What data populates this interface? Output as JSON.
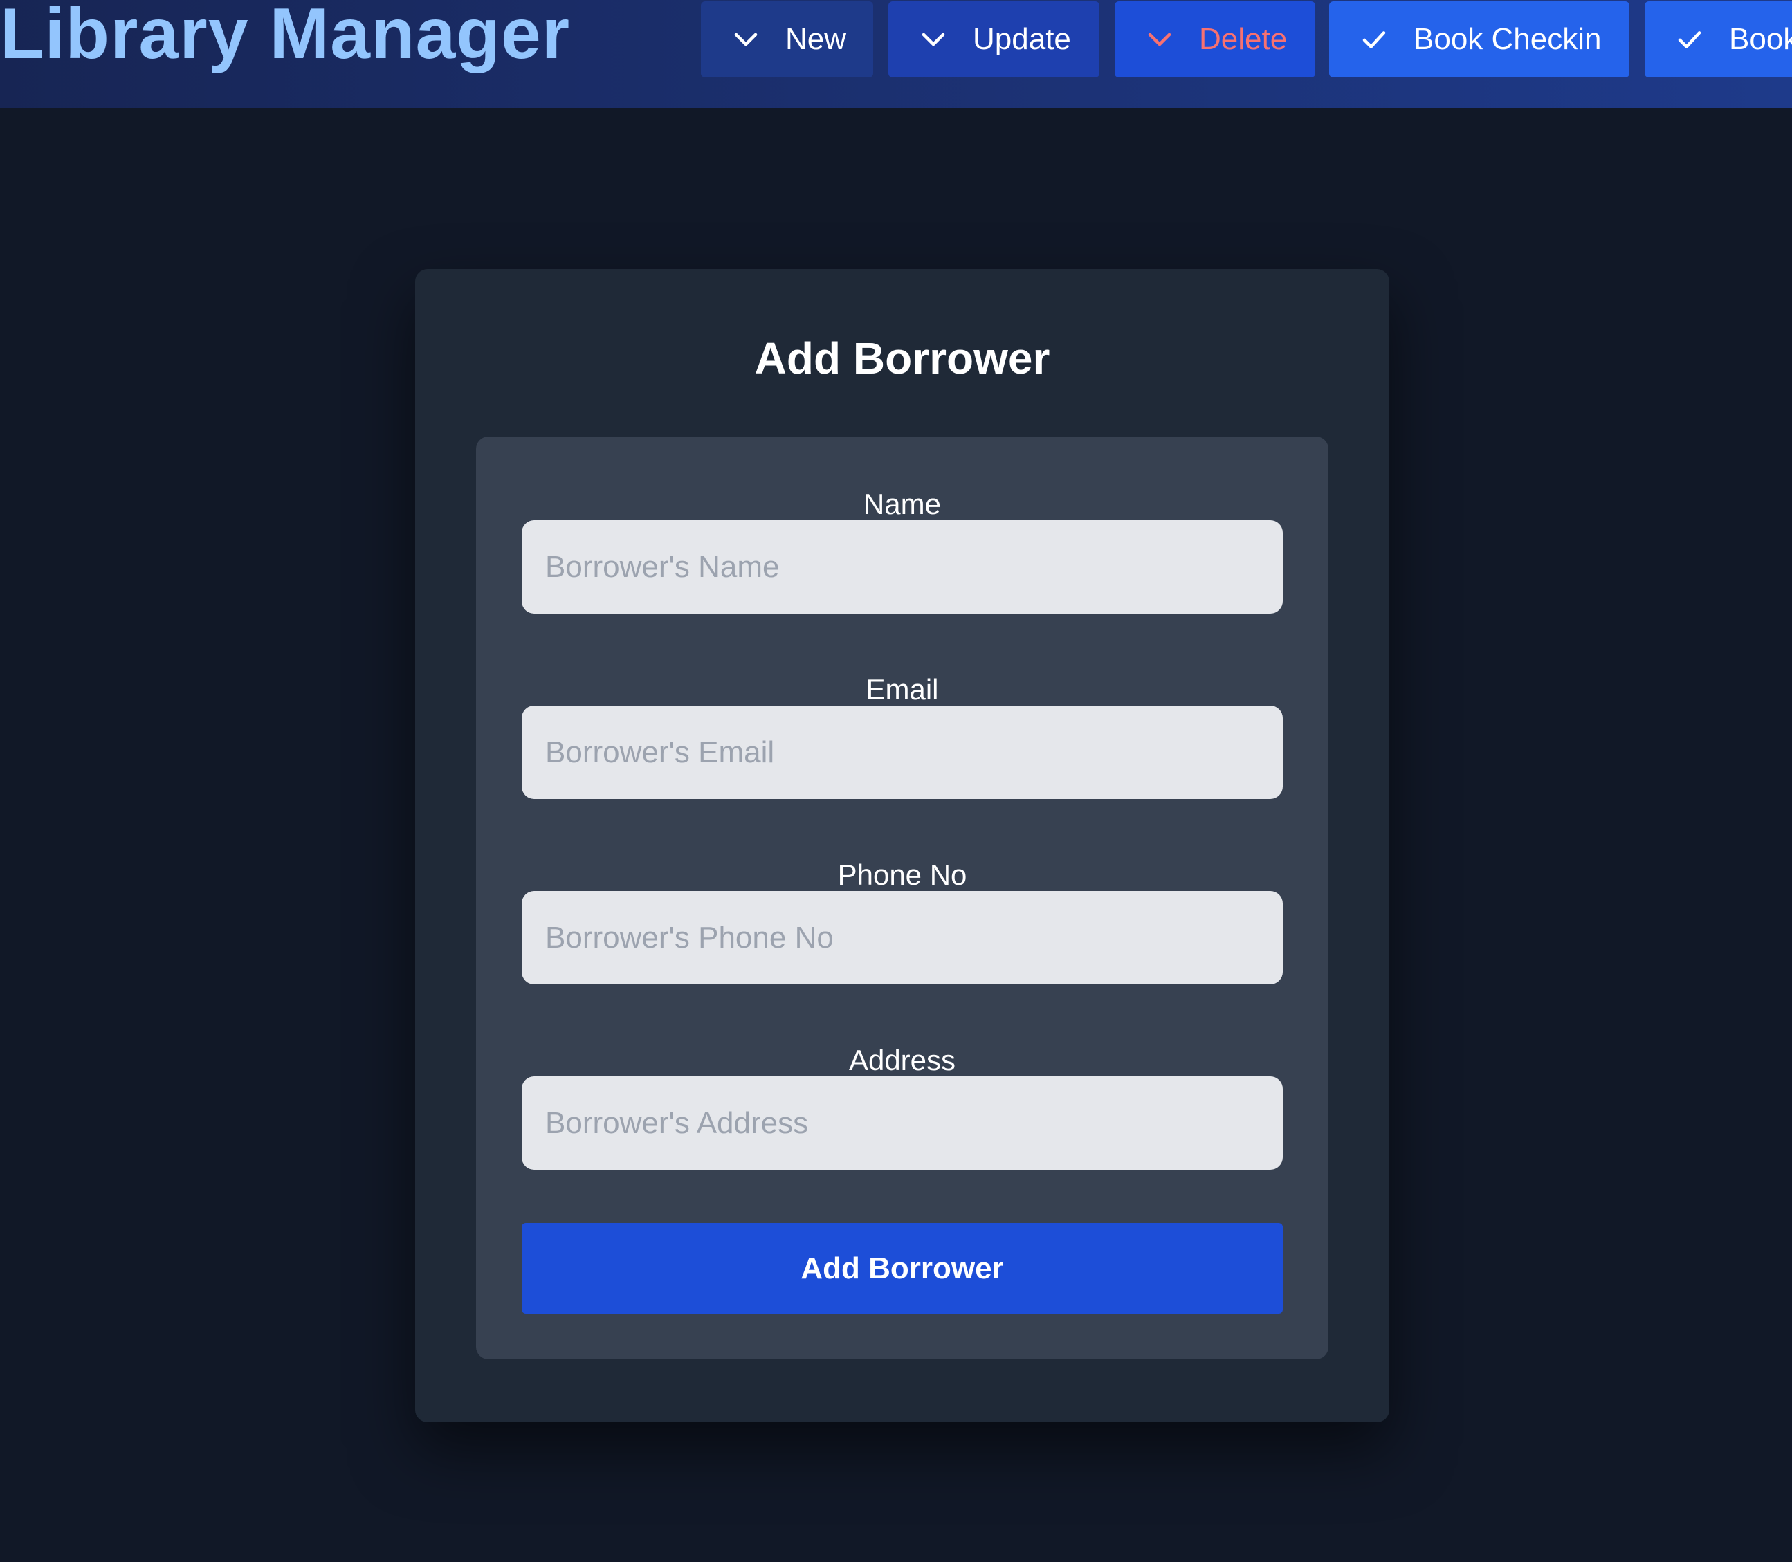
{
  "app": {
    "title": "Library Manager"
  },
  "nav": {
    "new_label": "New",
    "update_label": "Update",
    "delete_label": "Delete",
    "checkin_label": "Book Checkin",
    "checkout_label": "Book"
  },
  "icons": {
    "new": "chevron-down-icon",
    "update": "chevron-down-icon",
    "delete": "chevron-down-icon",
    "checkin": "check-icon",
    "checkout": "check-icon"
  },
  "form": {
    "title": "Add Borrower",
    "fields": [
      {
        "label": "Name",
        "placeholder": "Borrower's Name",
        "value": ""
      },
      {
        "label": "Email",
        "placeholder": "Borrower's Email",
        "value": ""
      },
      {
        "label": "Phone No",
        "placeholder": "Borrower's Phone No",
        "value": ""
      },
      {
        "label": "Address",
        "placeholder": "Borrower's Address",
        "value": ""
      }
    ],
    "submit_label": "Add Borrower"
  },
  "colors": {
    "page_bg": "#111827",
    "title": "#93c5fd",
    "delete_text": "#f87171",
    "primary": "#1d4ed8"
  }
}
